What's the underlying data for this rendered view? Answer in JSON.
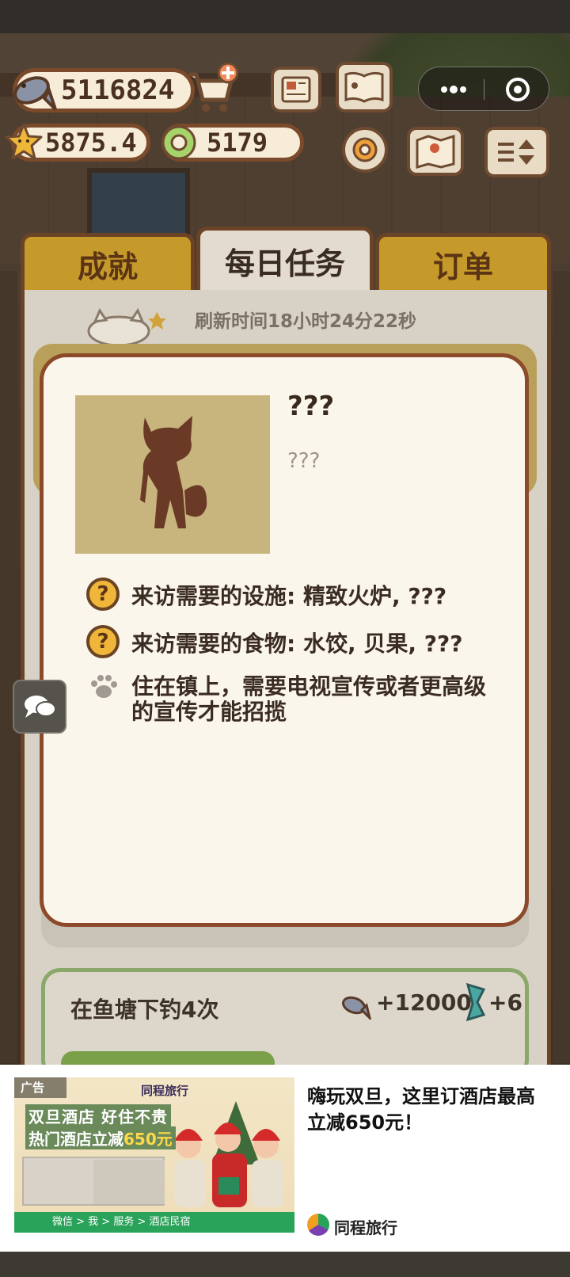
{
  "hud": {
    "fish": "5116824",
    "stars": "5875.4",
    "rings": "5179"
  },
  "tabs": [
    {
      "label": "成就"
    },
    {
      "label": "每日任务"
    },
    {
      "label": "订单"
    }
  ],
  "refresh": {
    "text": "刷新时间18小时24分22秒"
  },
  "visitor": {
    "name": "???",
    "subtitle": "???",
    "facility_req": "来访需要的设施: 精致火炉, ???",
    "food_req": "来访需要的食物: 水饺, 贝果, ???",
    "recruit_note": "住在镇上，需要电视宣传或者更高级的宣传才能招揽",
    "question_mark": "?"
  },
  "task": {
    "title": "在鱼塘下钓4次",
    "fish_reward": "+12000",
    "gem_reward": "+6"
  },
  "ad": {
    "tag": "广告",
    "brand_small": "同程旅行",
    "headline1": "双旦酒店 好住不贵",
    "headline2_prefix": "热门酒店立减",
    "headline2_amount": "650元",
    "bar_text": "微信 > 我 > 服务 > 酒店民宿",
    "title": "嗨玩双旦，这里订酒店最高立减650元！",
    "advertiser": "同程旅行"
  },
  "colors": {
    "tab_gold": "#c69a2a",
    "tab_active": "#e3dbd0",
    "modal_bg": "#fbf6ec",
    "modal_border": "#8c4a2a",
    "question_badge": "#f0b63a",
    "ad_bar": "#2aa35a"
  }
}
